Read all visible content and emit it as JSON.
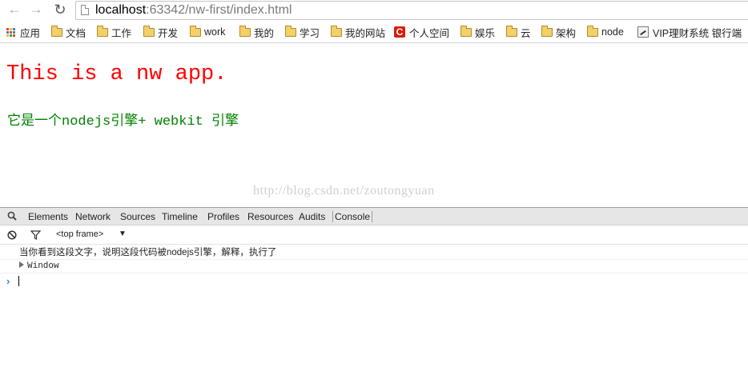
{
  "browser": {
    "url_host": "localhost",
    "url_path": ":63342/nw-first/index.html"
  },
  "bookmarks": [
    {
      "label": "应用",
      "icon": "apps-grid-icon"
    },
    {
      "label": "文档",
      "icon": "folder-icon"
    },
    {
      "label": "工作",
      "icon": "folder-icon"
    },
    {
      "label": "开发",
      "icon": "folder-icon"
    },
    {
      "label": "work",
      "icon": "folder-icon"
    },
    {
      "label": "我的",
      "icon": "folder-icon"
    },
    {
      "label": "学习",
      "icon": "folder-icon"
    },
    {
      "label": "我的网站",
      "icon": "folder-icon"
    },
    {
      "label": "个人空间",
      "icon": "c-logo-icon",
      "logo_text": "C"
    },
    {
      "label": "娱乐",
      "icon": "folder-icon"
    },
    {
      "label": "云",
      "icon": "folder-icon"
    },
    {
      "label": "架构",
      "icon": "folder-icon"
    },
    {
      "label": "node",
      "icon": "folder-icon"
    },
    {
      "label": "VIP理财系统 银行端",
      "icon": "chart-logo-icon"
    }
  ],
  "page": {
    "headline": "This is a nw app.",
    "subline": "它是一个nodejs引擎+ webkit 引擎",
    "watermark": "http://blog.csdn.net/zoutongyuan",
    "headline_color": "#ff0000",
    "subline_color": "#008000"
  },
  "devtools": {
    "tabs": [
      "Elements",
      "Network",
      "Sources",
      "Timeline",
      "Profiles",
      "Resources",
      "Audits",
      "Console"
    ],
    "active_tab": "Console",
    "frame_selector": "<top frame>",
    "console": {
      "message": "当你看到这段文字，说明这段代码被nodejs引擎，解释，执行了",
      "object": "Window",
      "prompt": "›"
    }
  }
}
